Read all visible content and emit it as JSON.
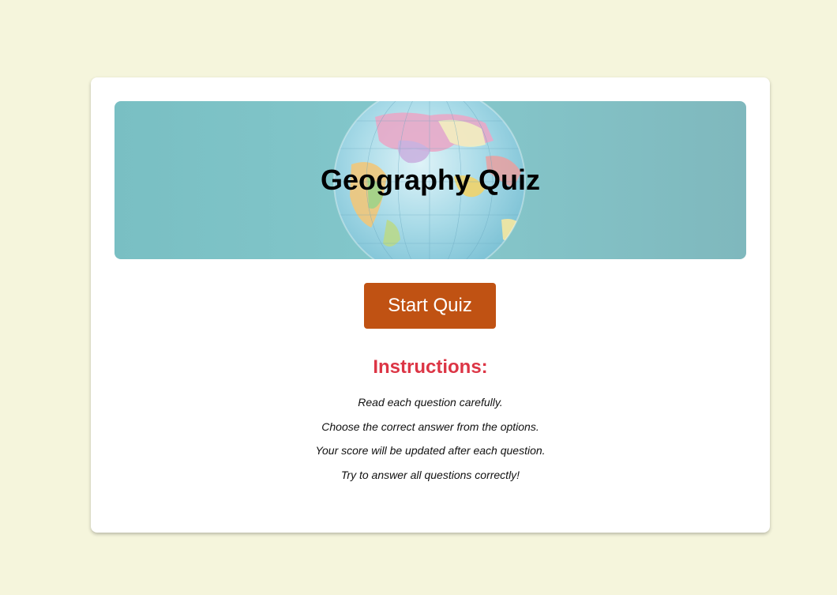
{
  "page": {
    "background_color": "#f5f5dc"
  },
  "banner": {
    "title": "Geography Quiz",
    "image_icon": "globe-icon"
  },
  "start_button": {
    "label": "Start Quiz",
    "color": "#c05213"
  },
  "instructions": {
    "heading": "Instructions:",
    "heading_color": "#dc3545",
    "items": [
      "Read each question carefully.",
      "Choose the correct answer from the options.",
      "Your score will be updated after each question.",
      "Try to answer all questions correctly!"
    ]
  }
}
